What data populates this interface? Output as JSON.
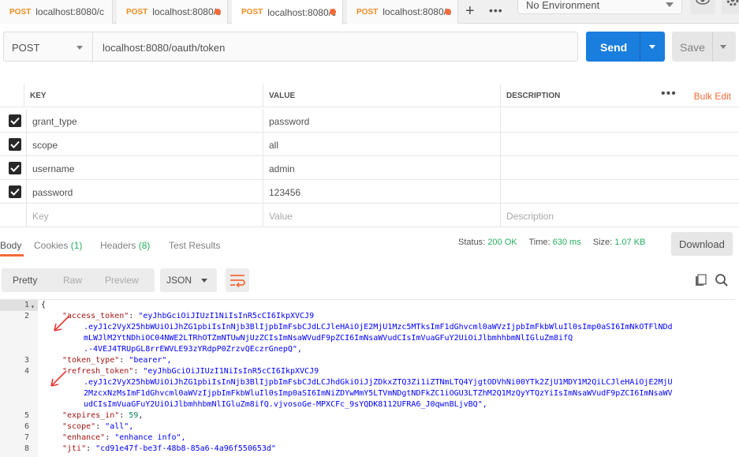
{
  "tabs": [
    {
      "method": "POST",
      "url": "localhost:8080/c",
      "dirty": false,
      "active": false
    },
    {
      "method": "POST",
      "url": "localhost:8080/c",
      "dirty": true,
      "active": false
    },
    {
      "method": "POST",
      "url": "localhost:8080/c",
      "dirty": true,
      "active": true
    },
    {
      "method": "POST",
      "url": "localhost:8080/c",
      "dirty": true,
      "active": false
    }
  ],
  "environment": "No Environment",
  "request": {
    "method": "POST",
    "url": "localhost:8080/oauth/token",
    "send_label": "Send",
    "save_label": "Save"
  },
  "params": {
    "headers": {
      "key": "KEY",
      "value": "VALUE",
      "description": "DESCRIPTION",
      "bulk_edit": "Bulk Edit"
    },
    "rows": [
      {
        "checked": true,
        "key": "grant_type",
        "value": "password"
      },
      {
        "checked": true,
        "key": "scope",
        "value": "all"
      },
      {
        "checked": true,
        "key": "username",
        "value": "admin"
      },
      {
        "checked": true,
        "key": "password",
        "value": "123456"
      }
    ],
    "placeholders": {
      "key": "Key",
      "value": "Value",
      "description": "Description"
    }
  },
  "response_tabs": {
    "body": "Body",
    "cookies": "Cookies",
    "cookies_count": "(1)",
    "headers": "Headers",
    "headers_count": "(8)",
    "tests": "Test Results"
  },
  "status": {
    "status_label": "Status:",
    "status_value": "200 OK",
    "time_label": "Time:",
    "time_value": "630 ms",
    "size_label": "Size:",
    "size_value": "1.07 KB"
  },
  "download_label": "Download",
  "view_modes": {
    "pretty": "Pretty",
    "raw": "Raw",
    "preview": "Preview"
  },
  "format": "JSON",
  "code_lines": [
    {
      "n": "1",
      "text": "{"
    },
    {
      "n": "2",
      "key": "\"access_token\"",
      "val": "\"eyJhbGciOiJIUzI1NiIsInR5cCI6IkpXVCJ9"
    },
    {
      "n": "",
      "cont": ".eyJ1c2VyX25hbWUiOiJhZG1pbiIsInNjb3BlIjpbImFsbCJdLCJleHAiOjE2MjU1Mzc5MTksImF1dGhvcml0aWVzIjpbImFkbWluIl0sImp0aSI6ImNkOTFlNDd"
    },
    {
      "n": "",
      "cont": "mLWJlM2YtNDhiOC04NWE2LTRhOTZmNTUwNjUzZCIsImNsaWVudF9pZCI6ImNsaWVudCIsImVuaGFuY2UiOiJlbmhhbmNlIGluZm8ifQ"
    },
    {
      "n": "",
      "cont": ".-4VEJ4TRUpGL8rrEWVLE93zYRdpP0ZrzvQEczrGnepQ\","
    },
    {
      "n": "3",
      "key": "\"token_type\"",
      "val": "\"bearer\","
    },
    {
      "n": "4",
      "key": "\"refresh_token\"",
      "val": "\"eyJhbGciOiJIUzI1NiIsInR5cCI6IkpXVCJ9"
    },
    {
      "n": "",
      "cont": ".eyJ1c2VyX25hbWUiOiJhZG1pbiIsInNjb3BlIjpbImFsbCJdLCJhdGkiOiJjZDkxZTQ3Zi1iZTNmLTQ4YjgtODVhNi00YTk2ZjU1MDY1M2QiLCJleHAiOjE2MjU"
    },
    {
      "n": "",
      "cont": "2MzcxNzMsImF1dGhvcml0aWVzIjpbImFkbWluIl0sImp0aSI6ImNiZDYwMmY5LTVmNDgtNDFkZC1iOGU3LTZhM2Q1MzQyYTQzYiIsImNsaWVudF9pZCI6ImNsaWV"
    },
    {
      "n": "",
      "cont": "udCIsImVuaGFuY2UiOiJlbmhhbmNlIGluZm8ifQ.vjvosoGe-MPXCFc_9sYQDK8112UFRA6_J0qwnBLjvBQ\","
    },
    {
      "n": "5",
      "key": "\"expires_in\"",
      "num": "59"
    },
    {
      "n": "6",
      "key": "\"scope\"",
      "val": "\"all\","
    },
    {
      "n": "7",
      "key": "\"enhance\"",
      "val": "\"enhance info\","
    },
    {
      "n": "8",
      "key": "\"jti\"",
      "val": "\"cd91e47f-be3f-48b8-85a6-4a96f550653d\""
    }
  ],
  "colors": {
    "accent": "#f26b3a",
    "send": "#1a7ede",
    "method": "#ef8c21",
    "ok": "#27ae60",
    "annotation": "#e53935"
  }
}
